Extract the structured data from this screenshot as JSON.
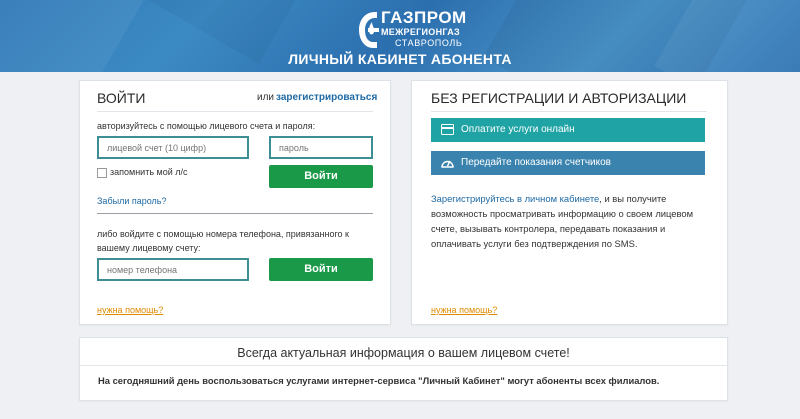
{
  "header": {
    "logo": {
      "line1": "ГАЗПРОМ",
      "line2": "МЕЖРЕГИОНГАЗ",
      "line3": "СТАВРОПОЛЬ",
      "icon": "gazprom-flame-icon"
    },
    "title": "ЛИЧНЫЙ КАБИНЕТ АБОНЕНТА"
  },
  "login": {
    "heading": "ВОЙТИ",
    "or_text": "или",
    "register_link": "зарегистрироваться",
    "account_hint": "авторизуйтесь с помощью лицевого счета и пароля:",
    "account_placeholder": "лицевой счет (10 цифр)",
    "password_placeholder": "пароль",
    "remember_label": "запомнить мой л/с",
    "login_button": "Войти",
    "forgot_link": "Забыли пароль?",
    "phone_hint": "либо войдите с помощью номера телефона, привязанного к вашему лицевому счету:",
    "phone_placeholder": "номер телефона",
    "phone_login_button": "Войти",
    "help_link": "нужна помощь?"
  },
  "noreg": {
    "heading": "БЕЗ РЕГИСТРАЦИИ И АВТОРИЗАЦИИ",
    "pay_button": "Оплатите услуги онлайн",
    "pay_icon": "credit-card-icon",
    "meter_button": "Передайте показания счетчиков",
    "meter_icon": "gauge-icon",
    "register_link": "Зарегистрируйтесь в личном кабинете",
    "description": ", и вы получите возможность просматривать информацию о своем лицевом счете, вызывать контролера, передавать показания и оплачивать услуги без подтверждения по SMS.",
    "help_link": "нужна помощь?"
  },
  "info": {
    "title": "Всегда актуальная информация о вашем лицевом счете!",
    "text": "На сегодняшний день воспользоваться услугами интернет-сервиса \"Личный Кабинет\" могут абоненты всех филиалов."
  },
  "colors": {
    "header": "#2f78b6",
    "login_green": "#1a9a48",
    "teal": "#20a3a5",
    "steel_blue": "#3a83ae",
    "input_border": "#3e8f93",
    "link_blue": "#1f6aa5",
    "help_orange": "#e08a00"
  }
}
